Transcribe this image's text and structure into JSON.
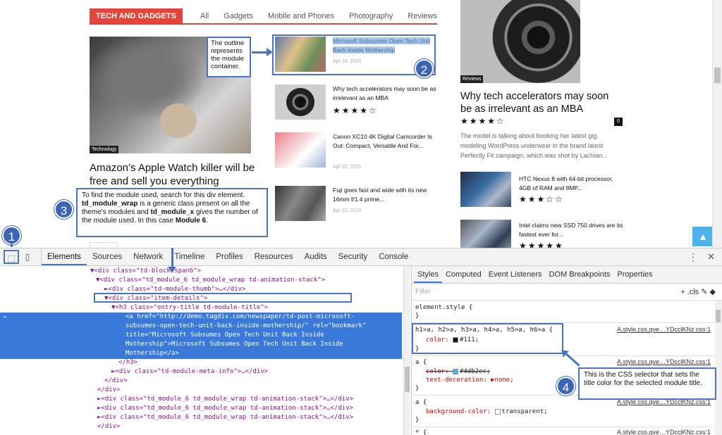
{
  "site": {
    "block_title": "TECH AND GADGETS",
    "filters": [
      "All",
      "Gadgets",
      "Mobile and Phones",
      "Photography",
      "Reviews"
    ],
    "main_category": "Technology",
    "main_title": "Amazon’s Apple Watch killer will be free and sell you everything",
    "list": [
      {
        "title": "Microsoft Subsumes Open Tech Unit Back Inside Mothership",
        "date": "Apr 24, 2015",
        "stars": ""
      },
      {
        "title": "Why tech accelerators may soon be as irrelevant as an MBA",
        "date": "",
        "stars": "★★★★☆"
      },
      {
        "title": "Canon XC10 4K Digital Camcorder Is Out: Compact, Versatile And For...",
        "date": "Apr 22, 2015",
        "stars": ""
      },
      {
        "title": "Fuji goes fast and wide with its new 16mm f/1.4 prime...",
        "date": "Apr 22, 2015",
        "stars": ""
      }
    ],
    "right_category": "Reviews",
    "right_title": "Why tech accelerators may soon be as irrelevant as an MBA",
    "right_stars": "★★★★☆",
    "right_comments": "0",
    "right_excerpt": "The model is talking about booking her latest gig, modeling WordPress underwear in the brand latest Perfectly Fit campaign, which was shot by Lachian...",
    "right_list": [
      {
        "title": "HTC Nexus 8 with 64-bit processor, 4GB of RAM and 8MP...",
        "stars": "★★★☆☆"
      },
      {
        "title": "Intel claims new SSD 750 drives are its fastest ever for...",
        "stars": "★★★★★"
      }
    ],
    "up_icon": "▲"
  },
  "notes": {
    "outline": "The outline represents the module container.",
    "module_intro": "To find the module used, search for this div element.",
    "module_wrap": "td_module_wrap",
    "module_mid": " is a generic class present on all the theme's modules and ",
    "module_x": "td_module_x",
    "module_end": " gives the number of the module used. In this case ",
    "module_name": "Module 6",
    "css": "This is the CSS selector that sets the title color for the selected module title."
  },
  "badges": [
    "1",
    "2",
    "3",
    "4"
  ],
  "devtools": {
    "tabs": [
      "Elements",
      "Sources",
      "Network",
      "Timeline",
      "Profiles",
      "Resources",
      "Audits",
      "Security",
      "Console"
    ],
    "menu_icon": "⋮",
    "close_icon": "✕",
    "style_tabs": [
      "Styles",
      "Computed",
      "Event Listeners",
      "DOM Breakpoints",
      "Properties"
    ],
    "filter_placeholder": "Filter",
    "filter_tools": "+  .cls",
    "source_link": "A.style.css,qve…YDcclKNz.css:1",
    "code": [
      {
        "indent": 130,
        "t": "▼<div class=\"td-block-span6\">"
      },
      {
        "indent": 138,
        "t": "▼<div class=\"td_module_6 td_module_wrap td-animation-stack\">"
      },
      {
        "indent": 150,
        "t": "►<div class=\"td-module-thumb\">…</div>"
      },
      {
        "indent": 150,
        "t": "▼<div class=\"item-details\">"
      },
      {
        "indent": 160,
        "t": "▼<h3 class=\"entry-title td-module-title\">"
      },
      {
        "indent": 180,
        "t": "<a href=\"http://demo.tagdiv.com/newspaper/td-post-microsoft-"
      },
      {
        "indent": 180,
        "t": "subsumes-open-tech-unit-back-inside-mothership/\" rel=\"bookmark\""
      },
      {
        "indent": 180,
        "t": "title=\"Microsoft Subsumes Open Tech Unit Back Inside"
      },
      {
        "indent": 180,
        "t": "Mothership\">Microsoft Subsumes Open Tech Unit Back Inside"
      },
      {
        "indent": 180,
        "t": "Mothership</a>"
      },
      {
        "indent": 170,
        "t": "</h3>"
      },
      {
        "indent": 160,
        "t": "►<div class=\"td-module-meta-info\">…</div>"
      },
      {
        "indent": 150,
        "t": "</div>"
      },
      {
        "indent": 140,
        "t": "</div>"
      },
      {
        "indent": 140,
        "t": "►<div class=\"td_module_6 td_module_wrap td-animation-stack\">…</div>"
      },
      {
        "indent": 140,
        "t": "►<div class=\"td_module_6 td_module_wrap td-animation-stack\">…</div>"
      },
      {
        "indent": 140,
        "t": "►<div class=\"td_module_6 td_module_wrap td-animation-stack\">…</div>"
      },
      {
        "indent": 140,
        "t": "</div>"
      }
    ],
    "dots": "…",
    "rules": {
      "element_style": "element.style {",
      "close": "}",
      "h_selector": "h1>a, h2>a, h3>a, h4>a, h5>a, h6>a {",
      "h_prop": "color:",
      "h_val": "#111;",
      "a1_selector": "a {",
      "a1_color_prop": "color:",
      "a1_color_val": "#4db2ec;",
      "a1_deco": "text-decoration: ▶none;",
      "a2_selector": "a {",
      "a2_prop": "background-color:",
      "a2_val": "transparent;",
      "more_selector": "* {"
    }
  },
  "colors": {
    "accent": "#e2463a",
    "blue": "#3879d9",
    "annotation": "#4b73c4",
    "link": "#4db2ec"
  }
}
